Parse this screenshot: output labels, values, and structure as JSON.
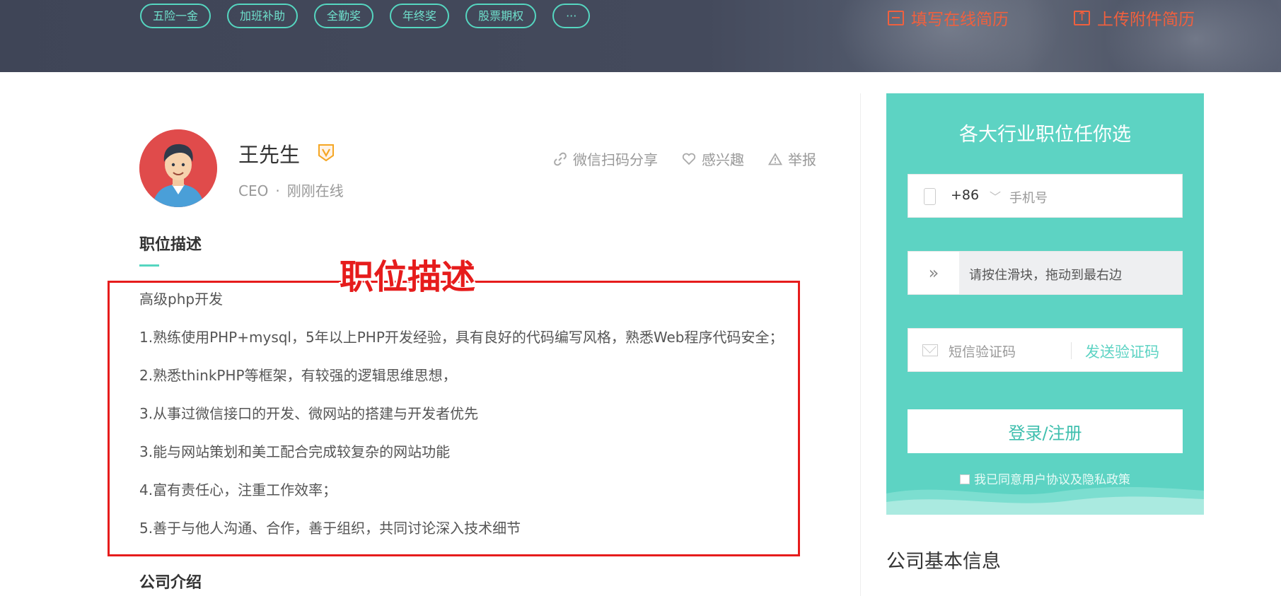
{
  "header": {
    "tags": [
      "五险一金",
      "加班补助",
      "全勤奖",
      "年终奖",
      "股票期权",
      "···"
    ],
    "fill_resume": "填写在线简历",
    "upload_resume": "上传附件简历",
    "accent_color": "#f0603e",
    "tag_color": "#55d6c0"
  },
  "recruiter": {
    "name": "王先生",
    "title": "CEO",
    "separator": "·",
    "status": "刚刚在线",
    "badge_icon": "verified-v-icon"
  },
  "actions": {
    "share": "微信扫码分享",
    "interest": "感兴趣",
    "report": "举报"
  },
  "job_description": {
    "title": "职位描述",
    "annotation": "职位描述",
    "lines": [
      "高级php开发",
      "1.熟练使用PHP+mysql，5年以上PHP开发经验，具有良好的代码编写风格，熟悉Web程序代码安全；",
      "2.熟悉thinkPHP等框架，有较强的逻辑思维思想，",
      "3.从事过微信接口的开发、微网站的搭建与开发者优先",
      "3.能与网站策划和美工配合完成较复杂的网站功能",
      "4.富有责任心，注重工作效率；",
      "5.善于与他人沟通、合作，善于组织，共同讨论深入技术细节"
    ]
  },
  "company_intro": {
    "title": "公司介绍"
  },
  "login": {
    "title": "各大行业职位任你选",
    "country_code": "+86",
    "phone_placeholder": "手机号",
    "slider_hint": "请按住滑块，拖动到最右边",
    "slider_icon": "»",
    "sms_placeholder": "短信验证码",
    "send_code": "发送验证码",
    "submit": "登录/注册",
    "agreement": "我已同意用户协议及隐私政策",
    "card_color": "#5dd3c3"
  },
  "sidebar": {
    "company_basic_info": "公司基本信息"
  }
}
